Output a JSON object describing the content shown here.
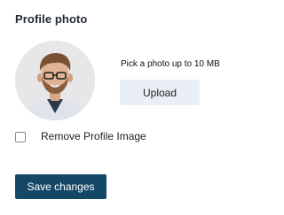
{
  "profile_photo": {
    "title": "Profile photo",
    "avatar_alt": "User profile picture",
    "hint": "Pick a photo up to 10 MB",
    "upload_label": "Upload"
  },
  "remove_option": {
    "label": "Remove Profile Image",
    "checked": false
  },
  "actions": {
    "save_label": "Save changes"
  },
  "colors": {
    "primary": "#154867",
    "upload_bg": "#e9eff5",
    "title_text": "#1f2937"
  }
}
